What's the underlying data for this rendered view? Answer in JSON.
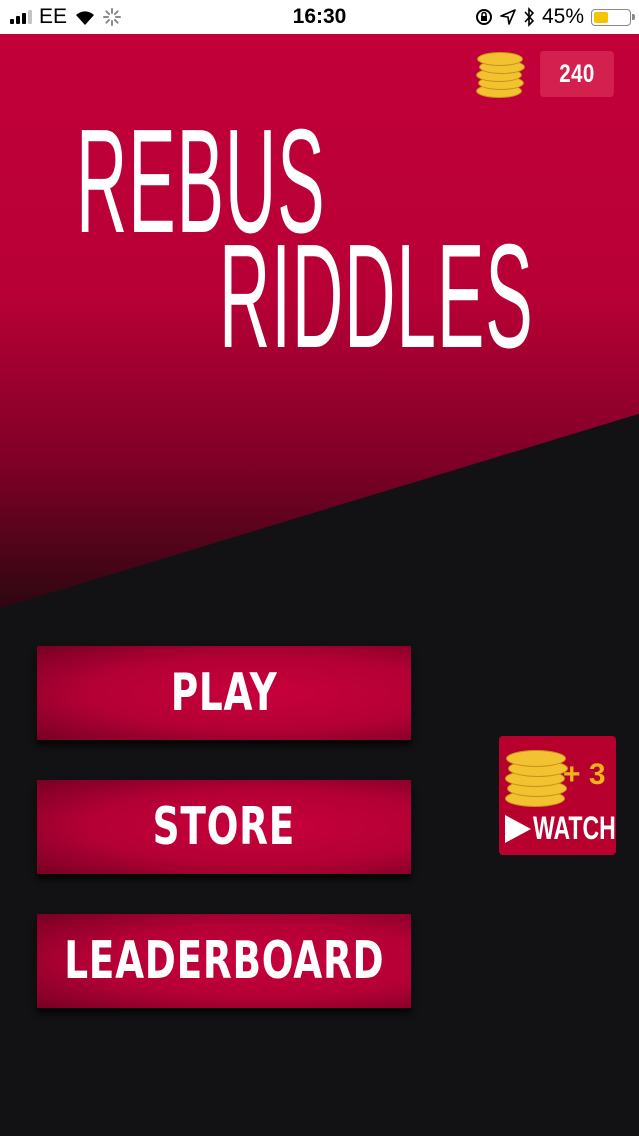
{
  "status_bar": {
    "carrier": "EE",
    "time": "16:30",
    "battery_percent": "45%",
    "battery_level": 0.45,
    "icons": [
      "signal-icon",
      "wifi-icon",
      "loading-spinner-icon",
      "rotation-lock-icon",
      "location-icon",
      "bluetooth-icon",
      "battery-icon"
    ]
  },
  "header": {
    "coins": "240",
    "coin_icon": "coin-stack-icon"
  },
  "title": {
    "line1": "REBUS",
    "line2": "RIDDLES"
  },
  "menu": {
    "play": "PLAY",
    "store": "STORE",
    "leaderboard": "LEADERBOARD"
  },
  "watch": {
    "bonus": "+ 3",
    "label": "WATCH",
    "icon": "play-icon"
  },
  "colors": {
    "accent": "#c2003a",
    "background": "#121113",
    "coin": "#f2c230",
    "coin_counter_bg": "#d4204e"
  }
}
